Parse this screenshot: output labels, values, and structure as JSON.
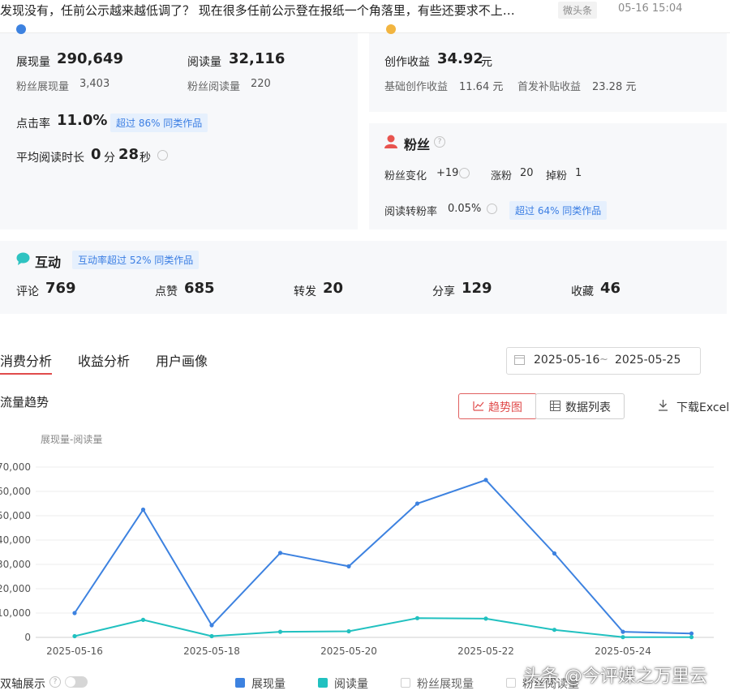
{
  "header": {
    "article_title": "发现没有，任前公示越来越低调了？ 现在很多任前公示登在报纸一个角落里，有些还要求不上…",
    "source_tag": "微头条",
    "timestamp": "05-16 15:04"
  },
  "stats": {
    "impressions_label": "展现量",
    "impressions_value": "290,649",
    "reads_label": "阅读量",
    "reads_value": "32,116",
    "fan_impressions_label": "粉丝展现量",
    "fan_impressions_value": "3,403",
    "fan_reads_label": "粉丝阅读量",
    "fan_reads_value": "220",
    "ctr_label": "点击率",
    "ctr_value": "11.0%",
    "ctr_badge": "超过 86% 同类作品",
    "avg_read_label": "平均阅读时长",
    "avg_read_min": "0",
    "avg_read_min_unit": "分",
    "avg_read_sec": "28",
    "avg_read_sec_unit": "秒"
  },
  "income": {
    "label": "创作收益",
    "value": "34.92",
    "unit": "元",
    "base_label": "基础创作收益",
    "base_value": "11.64 元",
    "first_label": "首发补贴收益",
    "first_value": "23.28 元"
  },
  "fans": {
    "title": "粉丝",
    "change_label": "粉丝变化",
    "change_value": "+19",
    "gain_label": "涨粉",
    "gain_value": "20",
    "loss_label": "掉粉",
    "loss_value": "1",
    "conv_label": "阅读转粉率",
    "conv_value": "0.05%",
    "conv_badge": "超过 64% 同类作品"
  },
  "interaction": {
    "title": "互动",
    "badge": "互动率超过 52% 同类作品",
    "items": [
      {
        "label": "评论",
        "value": "769"
      },
      {
        "label": "点赞",
        "value": "685"
      },
      {
        "label": "转发",
        "value": "20"
      },
      {
        "label": "分享",
        "value": "129"
      },
      {
        "label": "收藏",
        "value": "46"
      }
    ]
  },
  "tabs": [
    "消费分析",
    "收益分析",
    "用户画像"
  ],
  "date_range": {
    "start": "2025-05-16",
    "separator": "~",
    "end": "2025-05-25"
  },
  "trend": {
    "section_title": "流量趋势",
    "trend_button": "趋势图",
    "list_button": "数据列表",
    "download": "下载Excel",
    "chart_caption": "展现量-阅读量"
  },
  "legend": {
    "dual_axis": "双轴展示",
    "items": [
      {
        "label": "展现量",
        "checked": true
      },
      {
        "label": "阅读量",
        "checked": true
      },
      {
        "label": "粉丝展现量",
        "checked": false
      },
      {
        "label": "粉丝阅读量",
        "checked": false
      }
    ]
  },
  "watermark": "头条 @今评媒之万里云",
  "colors": {
    "impressions": "#3d82e0",
    "reads": "#21c1c0",
    "accent": "#e04b4b"
  },
  "chart_data": {
    "type": "line",
    "x": [
      "2025-05-16",
      "2025-05-17",
      "2025-05-18",
      "2025-05-19",
      "2025-05-20",
      "2025-05-21",
      "2025-05-22",
      "2025-05-23",
      "2025-05-24",
      "2025-05-25"
    ],
    "x_tick_labels": [
      "2025-05-16",
      "2025-05-18",
      "2025-05-20",
      "2025-05-22",
      "2025-05-24"
    ],
    "y_tick_labels": [
      "0",
      "10,000",
      "20,000",
      "30,000",
      "40,000",
      "50,000",
      "60,000",
      "70,000"
    ],
    "ylim": [
      0,
      70000
    ],
    "grid": true,
    "series": [
      {
        "name": "展现量",
        "color": "#3d82e0",
        "values": [
          10000,
          52500,
          5000,
          34700,
          29200,
          55000,
          64700,
          34500,
          2300,
          1600
        ]
      },
      {
        "name": "阅读量",
        "color": "#21c1c0",
        "values": [
          500,
          7200,
          500,
          2300,
          2500,
          7900,
          7700,
          3100,
          100,
          100
        ]
      }
    ]
  }
}
